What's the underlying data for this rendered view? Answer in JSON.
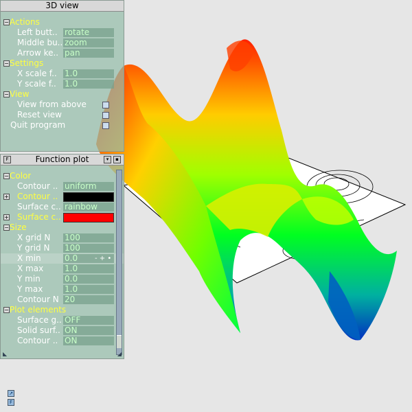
{
  "view_panel": {
    "title": "3D view",
    "actions_label": "Actions",
    "actions": [
      {
        "label": "Left butt..",
        "value": "rotate"
      },
      {
        "label": "Middle bu..",
        "value": "zoom"
      },
      {
        "label": "Arrow ke..",
        "value": "pan"
      }
    ],
    "settings_label": "Settings",
    "settings": [
      {
        "label": "X scale f..",
        "value": "1.0"
      },
      {
        "label": "Y scale f..",
        "value": "1.0"
      }
    ],
    "view_label": "View",
    "view_items": [
      "View from above",
      "Reset view"
    ],
    "quit_label": "Quit program"
  },
  "function_panel": {
    "title": "Function plot",
    "color_label": "Color",
    "color_rows": [
      {
        "label": "Contour ..",
        "value": "uniform"
      },
      {
        "label": "Contour ..",
        "swatch": "#000000"
      },
      {
        "label": "Surface c..",
        "value": "rainbow"
      },
      {
        "label": "Surface c..",
        "swatch": "#ff0000"
      }
    ],
    "size_label": "Size",
    "size_rows": [
      {
        "label": "X grid N",
        "value": "100"
      },
      {
        "label": "Y grid N",
        "value": "100"
      },
      {
        "label": "X min",
        "value": "0.0"
      },
      {
        "label": "X max",
        "value": "1.0"
      },
      {
        "label": "Y min",
        "value": "0.0"
      },
      {
        "label": "Y max",
        "value": "1.0"
      },
      {
        "label": "Contour N",
        "value": "20"
      }
    ],
    "stepper_glyph": "- + •",
    "elements_label": "Plot elements",
    "element_rows": [
      {
        "label": "Surface g..",
        "value": "OFF"
      },
      {
        "label": "Solid surf..",
        "value": "ON"
      },
      {
        "label": "Contour ..",
        "value": "ON"
      }
    ]
  },
  "colors": {
    "accent_yellow": "#ffff40",
    "panel_bg": "#96beaa",
    "value_text": "#c8ffc8",
    "background": "#e6e6e6"
  }
}
